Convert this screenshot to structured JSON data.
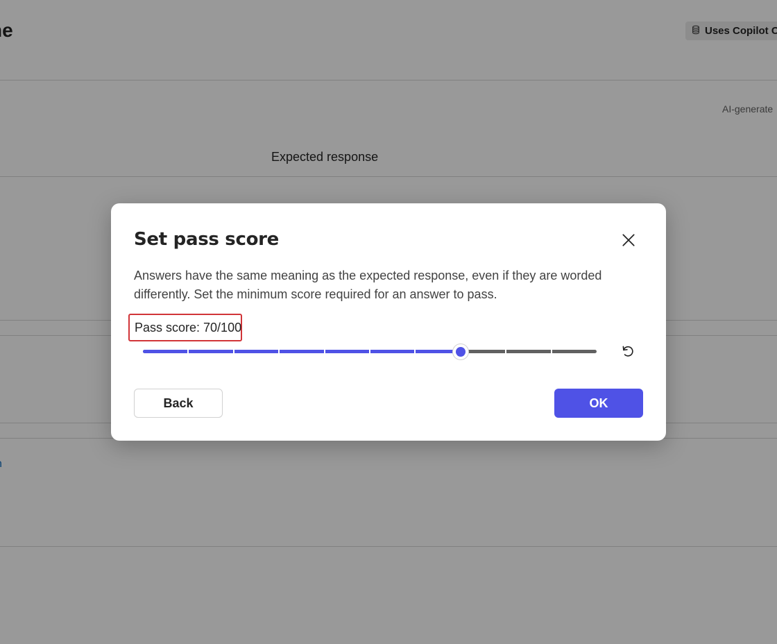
{
  "background": {
    "title_fragment": "ne",
    "badge_label": "Uses Copilot C",
    "ai_label": "AI-generate",
    "column_header": "Expected response",
    "link_fragment": "n"
  },
  "dialog": {
    "title": "Set pass score",
    "description": "Answers have the same meaning as the expected response, even if they are worded differently. Set the minimum score required for an answer to pass.",
    "score_label": "Pass score: 70/100",
    "slider": {
      "value": 70,
      "min": 0,
      "max": 100,
      "step": 10
    },
    "back_label": "Back",
    "ok_label": "OK"
  },
  "colors": {
    "accent": "#4f52e6",
    "highlight_border": "#d13438",
    "overlay": "rgba(0,0,0,0.4)"
  },
  "icons": {
    "close": "close-icon",
    "reset": "reset-icon",
    "badge": "database-icon"
  }
}
